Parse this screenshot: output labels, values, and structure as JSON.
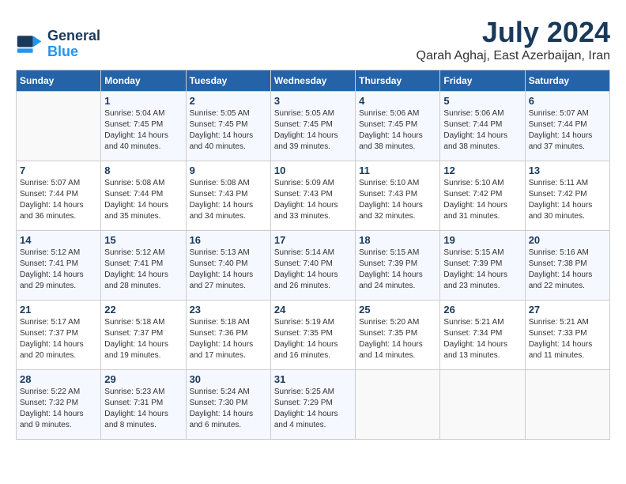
{
  "header": {
    "logo_line1": "General",
    "logo_line2": "Blue",
    "title": "July 2024",
    "subtitle": "Qarah Aghaj, East Azerbaijan, Iran"
  },
  "weekdays": [
    "Sunday",
    "Monday",
    "Tuesday",
    "Wednesday",
    "Thursday",
    "Friday",
    "Saturday"
  ],
  "weeks": [
    [
      {
        "day": "",
        "sunrise": "",
        "sunset": "",
        "daylight": ""
      },
      {
        "day": "1",
        "sunrise": "Sunrise: 5:04 AM",
        "sunset": "Sunset: 7:45 PM",
        "daylight": "Daylight: 14 hours and 40 minutes."
      },
      {
        "day": "2",
        "sunrise": "Sunrise: 5:05 AM",
        "sunset": "Sunset: 7:45 PM",
        "daylight": "Daylight: 14 hours and 40 minutes."
      },
      {
        "day": "3",
        "sunrise": "Sunrise: 5:05 AM",
        "sunset": "Sunset: 7:45 PM",
        "daylight": "Daylight: 14 hours and 39 minutes."
      },
      {
        "day": "4",
        "sunrise": "Sunrise: 5:06 AM",
        "sunset": "Sunset: 7:45 PM",
        "daylight": "Daylight: 14 hours and 38 minutes."
      },
      {
        "day": "5",
        "sunrise": "Sunrise: 5:06 AM",
        "sunset": "Sunset: 7:44 PM",
        "daylight": "Daylight: 14 hours and 38 minutes."
      },
      {
        "day": "6",
        "sunrise": "Sunrise: 5:07 AM",
        "sunset": "Sunset: 7:44 PM",
        "daylight": "Daylight: 14 hours and 37 minutes."
      }
    ],
    [
      {
        "day": "7",
        "sunrise": "Sunrise: 5:07 AM",
        "sunset": "Sunset: 7:44 PM",
        "daylight": "Daylight: 14 hours and 36 minutes."
      },
      {
        "day": "8",
        "sunrise": "Sunrise: 5:08 AM",
        "sunset": "Sunset: 7:44 PM",
        "daylight": "Daylight: 14 hours and 35 minutes."
      },
      {
        "day": "9",
        "sunrise": "Sunrise: 5:08 AM",
        "sunset": "Sunset: 7:43 PM",
        "daylight": "Daylight: 14 hours and 34 minutes."
      },
      {
        "day": "10",
        "sunrise": "Sunrise: 5:09 AM",
        "sunset": "Sunset: 7:43 PM",
        "daylight": "Daylight: 14 hours and 33 minutes."
      },
      {
        "day": "11",
        "sunrise": "Sunrise: 5:10 AM",
        "sunset": "Sunset: 7:43 PM",
        "daylight": "Daylight: 14 hours and 32 minutes."
      },
      {
        "day": "12",
        "sunrise": "Sunrise: 5:10 AM",
        "sunset": "Sunset: 7:42 PM",
        "daylight": "Daylight: 14 hours and 31 minutes."
      },
      {
        "day": "13",
        "sunrise": "Sunrise: 5:11 AM",
        "sunset": "Sunset: 7:42 PM",
        "daylight": "Daylight: 14 hours and 30 minutes."
      }
    ],
    [
      {
        "day": "14",
        "sunrise": "Sunrise: 5:12 AM",
        "sunset": "Sunset: 7:41 PM",
        "daylight": "Daylight: 14 hours and 29 minutes."
      },
      {
        "day": "15",
        "sunrise": "Sunrise: 5:12 AM",
        "sunset": "Sunset: 7:41 PM",
        "daylight": "Daylight: 14 hours and 28 minutes."
      },
      {
        "day": "16",
        "sunrise": "Sunrise: 5:13 AM",
        "sunset": "Sunset: 7:40 PM",
        "daylight": "Daylight: 14 hours and 27 minutes."
      },
      {
        "day": "17",
        "sunrise": "Sunrise: 5:14 AM",
        "sunset": "Sunset: 7:40 PM",
        "daylight": "Daylight: 14 hours and 26 minutes."
      },
      {
        "day": "18",
        "sunrise": "Sunrise: 5:15 AM",
        "sunset": "Sunset: 7:39 PM",
        "daylight": "Daylight: 14 hours and 24 minutes."
      },
      {
        "day": "19",
        "sunrise": "Sunrise: 5:15 AM",
        "sunset": "Sunset: 7:39 PM",
        "daylight": "Daylight: 14 hours and 23 minutes."
      },
      {
        "day": "20",
        "sunrise": "Sunrise: 5:16 AM",
        "sunset": "Sunset: 7:38 PM",
        "daylight": "Daylight: 14 hours and 22 minutes."
      }
    ],
    [
      {
        "day": "21",
        "sunrise": "Sunrise: 5:17 AM",
        "sunset": "Sunset: 7:37 PM",
        "daylight": "Daylight: 14 hours and 20 minutes."
      },
      {
        "day": "22",
        "sunrise": "Sunrise: 5:18 AM",
        "sunset": "Sunset: 7:37 PM",
        "daylight": "Daylight: 14 hours and 19 minutes."
      },
      {
        "day": "23",
        "sunrise": "Sunrise: 5:18 AM",
        "sunset": "Sunset: 7:36 PM",
        "daylight": "Daylight: 14 hours and 17 minutes."
      },
      {
        "day": "24",
        "sunrise": "Sunrise: 5:19 AM",
        "sunset": "Sunset: 7:35 PM",
        "daylight": "Daylight: 14 hours and 16 minutes."
      },
      {
        "day": "25",
        "sunrise": "Sunrise: 5:20 AM",
        "sunset": "Sunset: 7:35 PM",
        "daylight": "Daylight: 14 hours and 14 minutes."
      },
      {
        "day": "26",
        "sunrise": "Sunrise: 5:21 AM",
        "sunset": "Sunset: 7:34 PM",
        "daylight": "Daylight: 14 hours and 13 minutes."
      },
      {
        "day": "27",
        "sunrise": "Sunrise: 5:21 AM",
        "sunset": "Sunset: 7:33 PM",
        "daylight": "Daylight: 14 hours and 11 minutes."
      }
    ],
    [
      {
        "day": "28",
        "sunrise": "Sunrise: 5:22 AM",
        "sunset": "Sunset: 7:32 PM",
        "daylight": "Daylight: 14 hours and 9 minutes."
      },
      {
        "day": "29",
        "sunrise": "Sunrise: 5:23 AM",
        "sunset": "Sunset: 7:31 PM",
        "daylight": "Daylight: 14 hours and 8 minutes."
      },
      {
        "day": "30",
        "sunrise": "Sunrise: 5:24 AM",
        "sunset": "Sunset: 7:30 PM",
        "daylight": "Daylight: 14 hours and 6 minutes."
      },
      {
        "day": "31",
        "sunrise": "Sunrise: 5:25 AM",
        "sunset": "Sunset: 7:29 PM",
        "daylight": "Daylight: 14 hours and 4 minutes."
      },
      {
        "day": "",
        "sunrise": "",
        "sunset": "",
        "daylight": ""
      },
      {
        "day": "",
        "sunrise": "",
        "sunset": "",
        "daylight": ""
      },
      {
        "day": "",
        "sunrise": "",
        "sunset": "",
        "daylight": ""
      }
    ]
  ]
}
